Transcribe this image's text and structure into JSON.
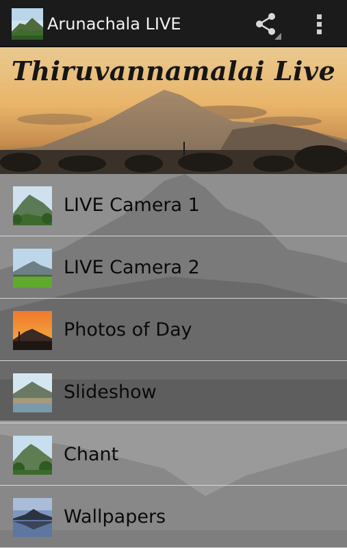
{
  "app_bar": {
    "title": "Arunachala LIVE",
    "icons": {
      "app": "app-logo-icon",
      "share": "share-icon",
      "overflow": "overflow-menu-icon"
    }
  },
  "banner": {
    "title": "Thiruvannamalai Live"
  },
  "menu": {
    "items": [
      {
        "label": "LIVE Camera 1",
        "icon": "mountain-photo-icon"
      },
      {
        "label": "LIVE Camera 2",
        "icon": "mountain-field-photo-icon"
      },
      {
        "label": "Photos of Day",
        "icon": "sunset-photo-icon"
      },
      {
        "label": "Slideshow",
        "icon": "mountain-town-photo-icon"
      },
      {
        "label": "Chant",
        "icon": "mountain-trees-photo-icon"
      },
      {
        "label": "Wallpapers",
        "icon": "mountain-reflection-photo-icon"
      }
    ]
  },
  "colors": {
    "action_bar": "#1b1b1b",
    "list_background": "#8a8a8a",
    "divider": "#d8d8d8"
  }
}
